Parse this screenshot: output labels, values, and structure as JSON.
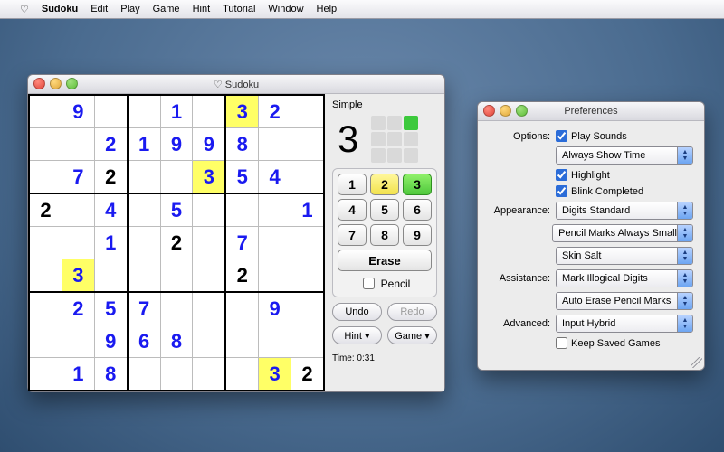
{
  "menubar": {
    "apple": "",
    "heart": "♡",
    "app": "Sudoku",
    "items": [
      "Edit",
      "Play",
      "Game",
      "Hint",
      "Tutorial",
      "Window",
      "Help"
    ]
  },
  "sudoku_window": {
    "title": "♡ Sudoku",
    "difficulty": "Simple",
    "selected_number": "3",
    "progress_done_index": 2,
    "erase_label": "Erase",
    "pencil_label": "Pencil",
    "pencil_checked": false,
    "undo_label": "Undo",
    "redo_label": "Redo",
    "hint_label": "Hint ▾",
    "game_label": "Game ▾",
    "timer_prefix": "Time:",
    "timer_value": "0:31",
    "numbers": [
      "1",
      "2",
      "3",
      "4",
      "5",
      "6",
      "7",
      "8",
      "9"
    ],
    "board": [
      [
        {
          "v": "",
          "t": ""
        },
        {
          "v": "9",
          "t": "p"
        },
        {
          "v": "",
          "t": ""
        },
        {
          "v": "",
          "t": ""
        },
        {
          "v": "1",
          "t": "p"
        },
        {
          "v": "",
          "t": ""
        },
        {
          "v": "3",
          "t": "p",
          "hl": true
        },
        {
          "v": "2",
          "t": "p"
        },
        {
          "v": "",
          "t": ""
        }
      ],
      [
        {
          "v": "",
          "t": ""
        },
        {
          "v": "",
          "t": ""
        },
        {
          "v": "2",
          "t": "p"
        },
        {
          "v": "1",
          "t": "p"
        },
        {
          "v": "9",
          "t": "p"
        },
        {
          "v": "9",
          "t": "p"
        },
        {
          "v": "8",
          "t": "p"
        },
        {
          "v": "",
          "t": ""
        },
        {
          "v": "",
          "t": ""
        }
      ],
      [
        {
          "v": "",
          "t": ""
        },
        {
          "v": "7",
          "t": "p"
        },
        {
          "v": "2",
          "t": "g"
        },
        {
          "v": "",
          "t": ""
        },
        {
          "v": "",
          "t": ""
        },
        {
          "v": "3",
          "t": "p",
          "hl": true
        },
        {
          "v": "5",
          "t": "p"
        },
        {
          "v": "4",
          "t": "p"
        },
        {
          "v": "",
          "t": ""
        }
      ],
      [
        {
          "v": "2",
          "t": "g"
        },
        {
          "v": "",
          "t": ""
        },
        {
          "v": "4",
          "t": "p"
        },
        {
          "v": "",
          "t": ""
        },
        {
          "v": "5",
          "t": "p"
        },
        {
          "v": "",
          "t": ""
        },
        {
          "v": "",
          "t": ""
        },
        {
          "v": "",
          "t": ""
        },
        {
          "v": "1",
          "t": "p"
        }
      ],
      [
        {
          "v": "",
          "t": ""
        },
        {
          "v": "",
          "t": ""
        },
        {
          "v": "1",
          "t": "p"
        },
        {
          "v": "",
          "t": ""
        },
        {
          "v": "2",
          "t": "g"
        },
        {
          "v": "",
          "t": ""
        },
        {
          "v": "7",
          "t": "p"
        },
        {
          "v": "",
          "t": ""
        },
        {
          "v": "",
          "t": ""
        }
      ],
      [
        {
          "v": "",
          "t": ""
        },
        {
          "v": "3",
          "t": "p",
          "hl": true
        },
        {
          "v": "",
          "t": ""
        },
        {
          "v": "",
          "t": ""
        },
        {
          "v": "",
          "t": ""
        },
        {
          "v": "",
          "t": ""
        },
        {
          "v": "2",
          "t": "g"
        },
        {
          "v": "",
          "t": ""
        },
        {
          "v": "",
          "t": ""
        }
      ],
      [
        {
          "v": "",
          "t": ""
        },
        {
          "v": "2",
          "t": "p"
        },
        {
          "v": "5",
          "t": "p"
        },
        {
          "v": "7",
          "t": "p"
        },
        {
          "v": "",
          "t": ""
        },
        {
          "v": "",
          "t": ""
        },
        {
          "v": "",
          "t": ""
        },
        {
          "v": "9",
          "t": "p"
        },
        {
          "v": "",
          "t": ""
        }
      ],
      [
        {
          "v": "",
          "t": ""
        },
        {
          "v": "",
          "t": ""
        },
        {
          "v": "9",
          "t": "p"
        },
        {
          "v": "6",
          "t": "p"
        },
        {
          "v": "8",
          "t": "p"
        },
        {
          "v": "",
          "t": ""
        },
        {
          "v": "",
          "t": ""
        },
        {
          "v": "",
          "t": ""
        },
        {
          "v": "",
          "t": ""
        }
      ],
      [
        {
          "v": "",
          "t": ""
        },
        {
          "v": "1",
          "t": "p"
        },
        {
          "v": "8",
          "t": "p"
        },
        {
          "v": "",
          "t": ""
        },
        {
          "v": "",
          "t": ""
        },
        {
          "v": "",
          "t": ""
        },
        {
          "v": "",
          "t": ""
        },
        {
          "v": "3",
          "t": "p",
          "hl": true
        },
        {
          "v": "2",
          "t": "g"
        }
      ]
    ]
  },
  "prefs_window": {
    "title": "Preferences",
    "labels": {
      "options": "Options:",
      "appearance": "Appearance:",
      "assistance": "Assistance:",
      "advanced": "Advanced:"
    },
    "play_sounds": {
      "label": "Play Sounds",
      "checked": true
    },
    "always_show_time": "Always Show Time",
    "highlight": {
      "label": "Highlight",
      "checked": true
    },
    "blink_completed": {
      "label": "Blink Completed",
      "checked": true
    },
    "digits_style": "Digits Standard",
    "pencil_style": "Pencil Marks Always Small",
    "skin": "Skin Salt",
    "assist1": "Mark Illogical Digits",
    "assist2": "Auto Erase Pencil Marks",
    "advanced_mode": "Input Hybrid",
    "keep_saved": {
      "label": "Keep Saved Games",
      "checked": false
    }
  }
}
